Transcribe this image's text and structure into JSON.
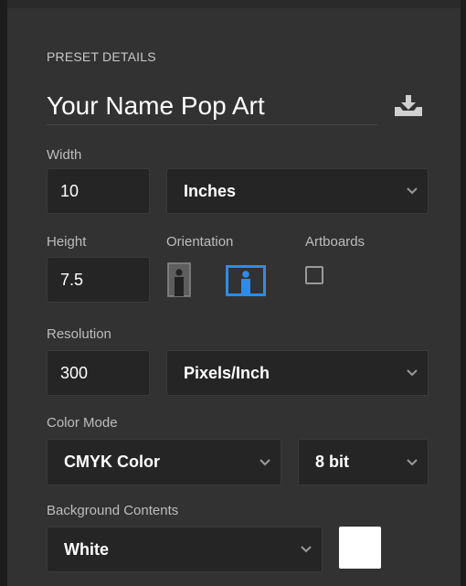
{
  "section_title": "PRESET DETAILS",
  "preset_name": "Your Name Pop Art",
  "width": {
    "label": "Width",
    "value": "10",
    "unit": "Inches"
  },
  "height": {
    "label": "Height",
    "value": "7.5"
  },
  "orientation": {
    "label": "Orientation",
    "selected": "landscape"
  },
  "artboards": {
    "label": "Artboards",
    "checked": false
  },
  "resolution": {
    "label": "Resolution",
    "value": "300",
    "unit": "Pixels/Inch"
  },
  "color_mode": {
    "label": "Color Mode",
    "mode": "CMYK Color",
    "depth": "8 bit"
  },
  "background": {
    "label": "Background Contents",
    "value": "White",
    "swatch_color": "#ffffff"
  },
  "colors": {
    "accent": "#2d8ceb",
    "panel_bg": "#323232",
    "field_bg": "#252525"
  },
  "icons": [
    "save-preset-icon",
    "chevron-down-icon",
    "portrait-orientation-icon",
    "landscape-orientation-icon"
  ]
}
